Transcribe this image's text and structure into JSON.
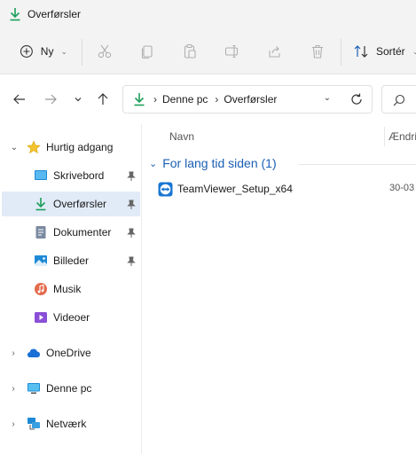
{
  "window": {
    "title": "Overførsler"
  },
  "commandbar": {
    "new_label": "Ny",
    "sort_label": "Sortér",
    "tools": [
      "cut-icon",
      "copy-icon",
      "paste-icon",
      "rename-icon",
      "share-icon",
      "delete-icon"
    ]
  },
  "address": {
    "crumbs": [
      "Denne pc",
      "Overførsler"
    ]
  },
  "sidebar": {
    "quick_access": "Hurtig adgang",
    "items": [
      {
        "label": "Skrivebord",
        "icon": "desktop-icon",
        "pinned": true
      },
      {
        "label": "Overførsler",
        "icon": "download-icon",
        "pinned": true,
        "selected": true
      },
      {
        "label": "Dokumenter",
        "icon": "documents-icon",
        "pinned": true
      },
      {
        "label": "Billeder",
        "icon": "pictures-icon",
        "pinned": true
      },
      {
        "label": "Musik",
        "icon": "music-icon",
        "pinned": false
      },
      {
        "label": "Videoer",
        "icon": "videos-icon",
        "pinned": false
      }
    ],
    "onedrive": "OneDrive",
    "thispc": "Denne pc",
    "network": "Netværk"
  },
  "main": {
    "columns": {
      "name": "Navn",
      "date": "Ændri"
    },
    "group_label": "For lang tid siden (1)",
    "files": [
      {
        "name": "TeamViewer_Setup_x64",
        "date": "30-03"
      }
    ]
  },
  "colors": {
    "accent": "#1a5fb4",
    "selected": "#e1ebf7",
    "download_green": "#1e9e5a"
  }
}
